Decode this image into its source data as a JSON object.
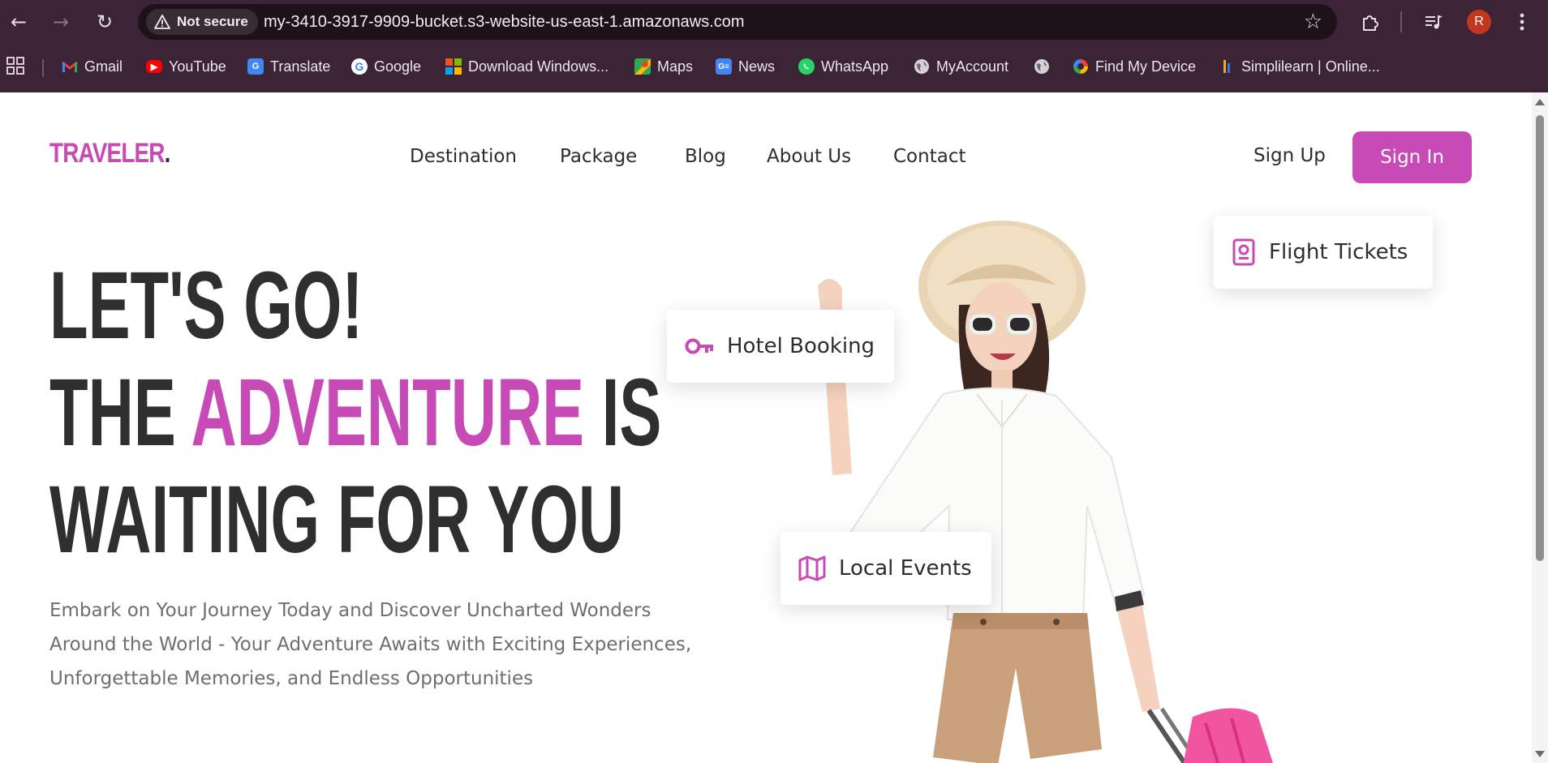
{
  "browser": {
    "security_label": "Not secure",
    "url": "my-3410-3917-9909-bucket.s3-website-us-east-1.amazonaws.com",
    "profile_initial": "R",
    "bookmarks": [
      {
        "label": "Gmail",
        "icon": "gmail-icon"
      },
      {
        "label": "YouTube",
        "icon": "youtube-icon"
      },
      {
        "label": "Translate",
        "icon": "translate-icon"
      },
      {
        "label": "Google",
        "icon": "google-icon"
      },
      {
        "label": "Download Windows...",
        "icon": "windows-icon"
      },
      {
        "label": "Maps",
        "icon": "maps-icon"
      },
      {
        "label": "News",
        "icon": "news-icon"
      },
      {
        "label": "WhatsApp",
        "icon": "whatsapp-icon"
      },
      {
        "label": "MyAccount",
        "icon": "globe-icon"
      },
      {
        "label": "",
        "icon": "globe-icon"
      },
      {
        "label": "Find My Device",
        "icon": "find-my-device-icon"
      },
      {
        "label": "Simplilearn | Online...",
        "icon": "simplilearn-icon"
      }
    ]
  },
  "site": {
    "logo": "TRAVELER",
    "logo_dot": ".",
    "nav": [
      "Destination",
      "Package",
      "Blog",
      "About Us",
      "Contact"
    ],
    "signup_label": "Sign Up",
    "signin_label": "Sign In",
    "accent_color": "#c84ab6"
  },
  "hero": {
    "line1": "LET'S GO!",
    "line2_pre": "THE ",
    "line2_accent": "ADVENTURE",
    "line2_post": " IS",
    "line3": "WAITING FOR YOU",
    "description": [
      "Embark on Your Journey Today and Discover Uncharted Wonders",
      "Around the World - Your Adventure Awaits with Exciting Experiences,",
      "Unforgettable Memories, and Endless Opportunities"
    ]
  },
  "features": {
    "flight": {
      "label": "Flight Tickets",
      "icon": "passport-icon"
    },
    "hotel": {
      "label": "Hotel Booking",
      "icon": "key-icon"
    },
    "events": {
      "label": "Local Events",
      "icon": "map-icon"
    }
  }
}
